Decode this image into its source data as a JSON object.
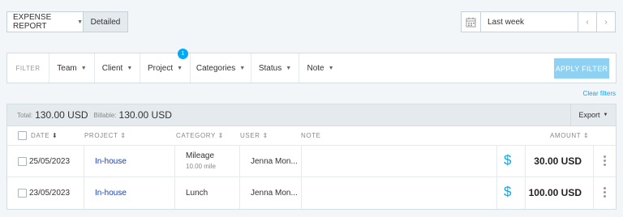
{
  "toolbar": {
    "report_type": "EXPENSE REPORT",
    "view_mode": "Detailed",
    "date_range": "Last week",
    "prev_icon": "‹",
    "next_icon": "›"
  },
  "filters": {
    "title": "FILTER",
    "items": [
      {
        "label": "Team"
      },
      {
        "label": "Client"
      },
      {
        "label": "Project",
        "badge": "1"
      },
      {
        "label": "Categories"
      },
      {
        "label": "Status"
      },
      {
        "label": "Note"
      }
    ],
    "apply_label": "APPLY FILTER",
    "clear_label": "Clear filters"
  },
  "summary": {
    "total_label": "Total:",
    "total_value": "130.00 USD",
    "billable_label": "Billable:",
    "billable_value": "130.00 USD",
    "export_label": "Export"
  },
  "columns": {
    "date": "DATE",
    "project": "PROJECT",
    "category": "CATEGORY",
    "user": "USER",
    "note": "NOTE",
    "amount": "AMOUNT"
  },
  "rows": [
    {
      "date": "25/05/2023",
      "project": "In-house",
      "category": "Mileage",
      "category_sub": "10.00 mile",
      "user": "Jenna Mon...",
      "note": "",
      "amount": "30.00 USD"
    },
    {
      "date": "23/05/2023",
      "project": "In-house",
      "category": "Lunch",
      "category_sub": "",
      "user": "Jenna Mon...",
      "note": "",
      "amount": "100.00 USD"
    }
  ],
  "colors": {
    "accent": "#03a9f4",
    "apply_disabled": "#8fd1f2",
    "project_link": "#1a3cb5",
    "background": "#f2f6f8"
  }
}
